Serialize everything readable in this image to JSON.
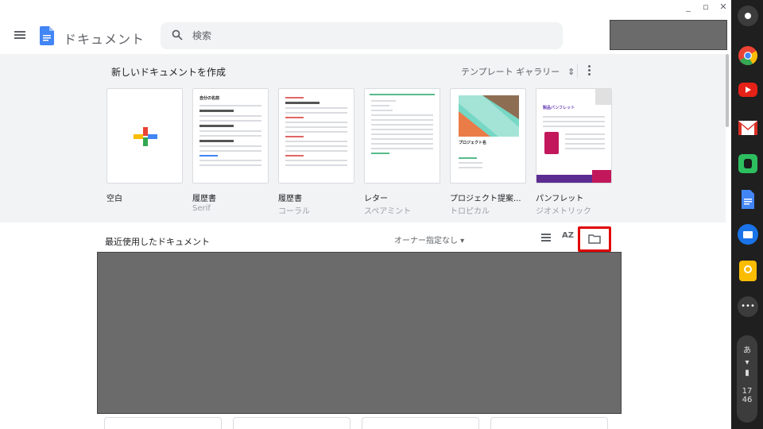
{
  "header": {
    "app_title": "ドキュメント",
    "search_placeholder": "検索"
  },
  "gallery": {
    "title": "新しいドキュメントを作成",
    "toggle_label": "テンプレート ギャラリー",
    "templates": [
      {
        "name": "空白",
        "sub": ""
      },
      {
        "name": "履歴書",
        "sub": "Serif"
      },
      {
        "name": "履歴書",
        "sub": "コーラル"
      },
      {
        "name": "レター",
        "sub": "スペアミント"
      },
      {
        "name": "プロジェクト提案...",
        "sub": "トロピカル"
      },
      {
        "name": "パンフレット",
        "sub": "ジオメトリック"
      }
    ],
    "thumb_texts": {
      "resume_serif": "自分の名前",
      "project": "プロジェクト名",
      "brochure": "製品パンフレット"
    }
  },
  "recent": {
    "title": "最近使用したドキュメント",
    "owner_filter": "オーナー指定なし ▾",
    "sort_label": "AZ"
  },
  "shelf": {
    "ime": "あ",
    "time_hour": "17",
    "time_min": "46"
  },
  "colors": {
    "accent_red": "#e00000",
    "docs_blue": "#4285f4",
    "gallery_bg": "#f1f3f4"
  }
}
